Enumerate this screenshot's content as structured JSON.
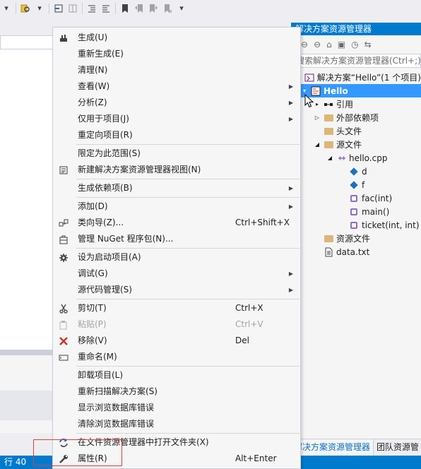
{
  "toolbar": {
    "icons": [
      "dropdown-arrow",
      "find-in-files",
      "dropdown-arrow",
      "step-into",
      "sync",
      "outdent",
      "indent",
      "bookmark",
      "prev-bookmark",
      "next-bookmark",
      "clear-bookmarks",
      "dropdown-arrow"
    ]
  },
  "solution_explorer": {
    "title": "解决方案资源管理器",
    "search_placeholder": "搜索解决方案资源管理器(Ctrl+;)",
    "tree": [
      {
        "label": "解决方案“Hello”(1 个项目)",
        "indent": 0,
        "arrow": "",
        "icon": "solution-icon"
      },
      {
        "label": "Hello",
        "indent": 0,
        "arrow": "▾",
        "icon": "project-icon",
        "selected": true
      },
      {
        "label": "引用",
        "indent": 1,
        "arrow": "▸",
        "icon": "references-icon"
      },
      {
        "label": "外部依赖项",
        "indent": 1,
        "arrow": "▷",
        "icon": "external-deps-icon"
      },
      {
        "label": "头文件",
        "indent": 1,
        "arrow": "",
        "icon": "folder-icon"
      },
      {
        "label": "源文件",
        "indent": 1,
        "arrow": "◢",
        "icon": "folder-icon"
      },
      {
        "label": "hello.cpp",
        "indent": 2,
        "arrow": "◢",
        "icon": "cpp-file-icon"
      },
      {
        "label": "d",
        "indent": 3,
        "arrow": "",
        "icon": "field-icon"
      },
      {
        "label": "f",
        "indent": 3,
        "arrow": "",
        "icon": "field-icon"
      },
      {
        "label": "fac(int)",
        "indent": 3,
        "arrow": "",
        "icon": "method-icon"
      },
      {
        "label": "main()",
        "indent": 3,
        "arrow": "",
        "icon": "method-icon"
      },
      {
        "label": "ticket(int, int)",
        "indent": 3,
        "arrow": "",
        "icon": "method-icon"
      },
      {
        "label": "资源文件",
        "indent": 1,
        "arrow": "",
        "icon": "folder-icon"
      },
      {
        "label": "data.txt",
        "indent": 1,
        "arrow": "",
        "icon": "text-file-icon"
      }
    ],
    "tabs": {
      "active": "解决方案资源管理器",
      "inactive": "团队资源管"
    }
  },
  "context_menu": {
    "items": [
      {
        "label": "生成(U)",
        "shortcut": "",
        "submenu": false,
        "icon": "build-icon",
        "disabled": false
      },
      {
        "label": "重新生成(E)",
        "shortcut": "",
        "submenu": false,
        "icon": "",
        "disabled": false
      },
      {
        "label": "清理(N)",
        "shortcut": "",
        "submenu": false,
        "icon": "",
        "disabled": false
      },
      {
        "label": "查看(W)",
        "shortcut": "",
        "submenu": true,
        "icon": "",
        "disabled": false
      },
      {
        "label": "分析(Z)",
        "shortcut": "",
        "submenu": true,
        "icon": "",
        "disabled": false
      },
      {
        "label": "仅用于项目(J)",
        "shortcut": "",
        "submenu": true,
        "icon": "",
        "disabled": false
      },
      {
        "label": "重定向项目(R)",
        "shortcut": "",
        "submenu": false,
        "icon": "",
        "disabled": false
      },
      {
        "label": "限定为此范围(S)",
        "shortcut": "",
        "submenu": false,
        "icon": "",
        "disabled": false
      },
      {
        "label": "新建解决方案资源管理器视图(N)",
        "shortcut": "",
        "submenu": false,
        "icon": "new-view-icon",
        "disabled": false
      },
      {
        "label": "生成依赖项(B)",
        "shortcut": "",
        "submenu": true,
        "icon": "",
        "disabled": false
      },
      {
        "label": "添加(D)",
        "shortcut": "",
        "submenu": true,
        "icon": "",
        "disabled": false
      },
      {
        "label": "类向导(Z)...",
        "shortcut": "Ctrl+Shift+X",
        "submenu": false,
        "icon": "class-wizard-icon",
        "disabled": false
      },
      {
        "label": "管理 NuGet 程序包(N)...",
        "shortcut": "",
        "submenu": false,
        "icon": "nuget-icon",
        "disabled": false
      },
      {
        "label": "设为启动项目(A)",
        "shortcut": "",
        "submenu": false,
        "icon": "gear-icon",
        "disabled": false
      },
      {
        "label": "调试(G)",
        "shortcut": "",
        "submenu": true,
        "icon": "",
        "disabled": false
      },
      {
        "label": "源代码管理(S)",
        "shortcut": "",
        "submenu": true,
        "icon": "",
        "disabled": false
      },
      {
        "label": "剪切(T)",
        "shortcut": "Ctrl+X",
        "submenu": false,
        "icon": "scissors-icon",
        "disabled": false
      },
      {
        "label": "粘贴(P)",
        "shortcut": "Ctrl+V",
        "submenu": false,
        "icon": "paste-icon",
        "disabled": true
      },
      {
        "label": "移除(V)",
        "shortcut": "Del",
        "submenu": false,
        "icon": "remove-icon",
        "disabled": false
      },
      {
        "label": "重命名(M)",
        "shortcut": "",
        "submenu": false,
        "icon": "rename-icon",
        "disabled": false
      },
      {
        "label": "卸载项目(L)",
        "shortcut": "",
        "submenu": false,
        "icon": "",
        "disabled": false
      },
      {
        "label": "重新扫描解决方案(S)",
        "shortcut": "",
        "submenu": false,
        "icon": "",
        "disabled": false
      },
      {
        "label": "显示浏览数据库错误",
        "shortcut": "",
        "submenu": false,
        "icon": "",
        "disabled": false
      },
      {
        "label": "清除浏览数据库错误",
        "shortcut": "",
        "submenu": false,
        "icon": "",
        "disabled": false
      },
      {
        "label": "在文件资源管理器中打开文件夹(X)",
        "shortcut": "",
        "submenu": false,
        "icon": "open-folder-icon",
        "disabled": false
      },
      {
        "label": "属性(R)",
        "shortcut": "Alt+Enter",
        "submenu": false,
        "icon": "wrench-icon",
        "disabled": false
      }
    ]
  },
  "status_bar": {
    "text": "行 40"
  },
  "colors": {
    "accent": "#007acc",
    "selection": "#3399ff",
    "menu_bg": "#f6f6f6",
    "highlight_box": "#e03c3c"
  }
}
